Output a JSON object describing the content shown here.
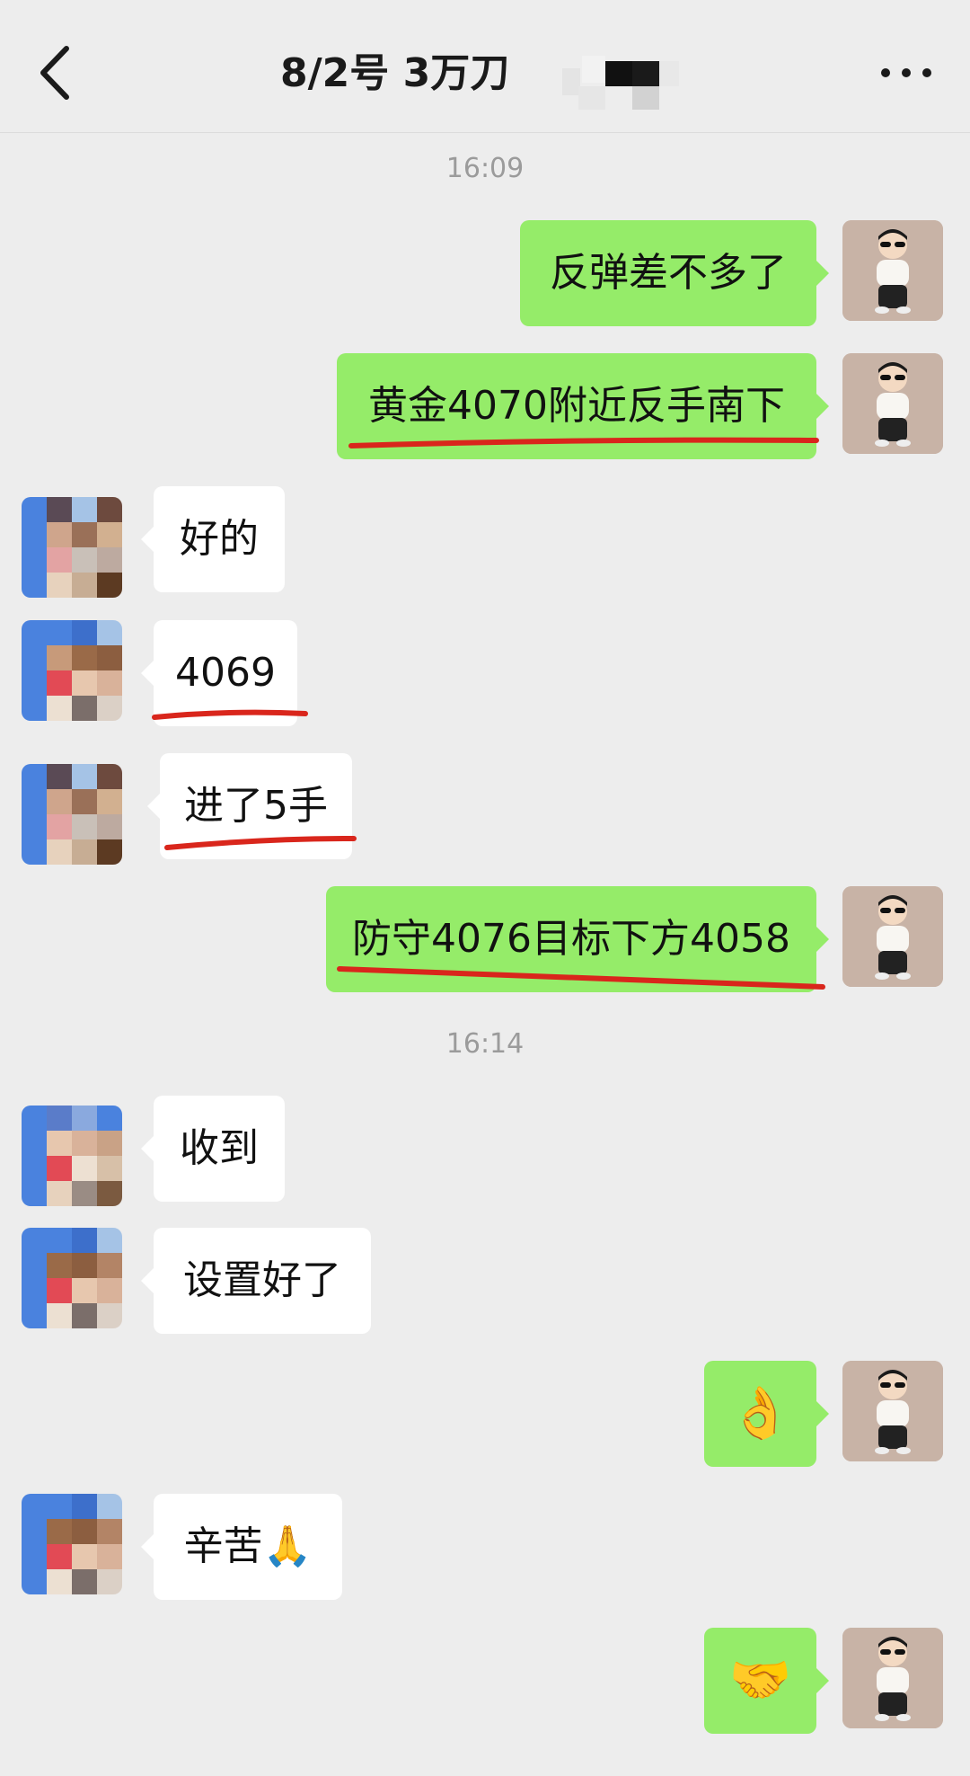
{
  "header": {
    "title": "8/2号  3万刀"
  },
  "timestamps": [
    "16:09",
    "16:14"
  ],
  "messages": [
    {
      "from": "me",
      "text": "反弹差不多了"
    },
    {
      "from": "me",
      "text": "黄金4070附近反手南下"
    },
    {
      "from": "other",
      "text": "好的"
    },
    {
      "from": "other",
      "text": "4069"
    },
    {
      "from": "other",
      "text": "进了5手"
    },
    {
      "from": "me",
      "text": "防守4076目标下方4058"
    },
    {
      "from": "other",
      "text": "收到"
    },
    {
      "from": "other",
      "text": "设置好了"
    },
    {
      "from": "me",
      "text": "👌"
    },
    {
      "from": "other",
      "text": "辛苦🙏"
    },
    {
      "from": "me",
      "text": "🤝"
    }
  ],
  "colors": {
    "background": "#ededed",
    "my_bubble": "#95ec69",
    "their_bubble": "#ffffff",
    "annotation_underline": "#d9261c"
  },
  "icons": {
    "back": "chevron-left-icon",
    "more": "more-dots-icon"
  }
}
